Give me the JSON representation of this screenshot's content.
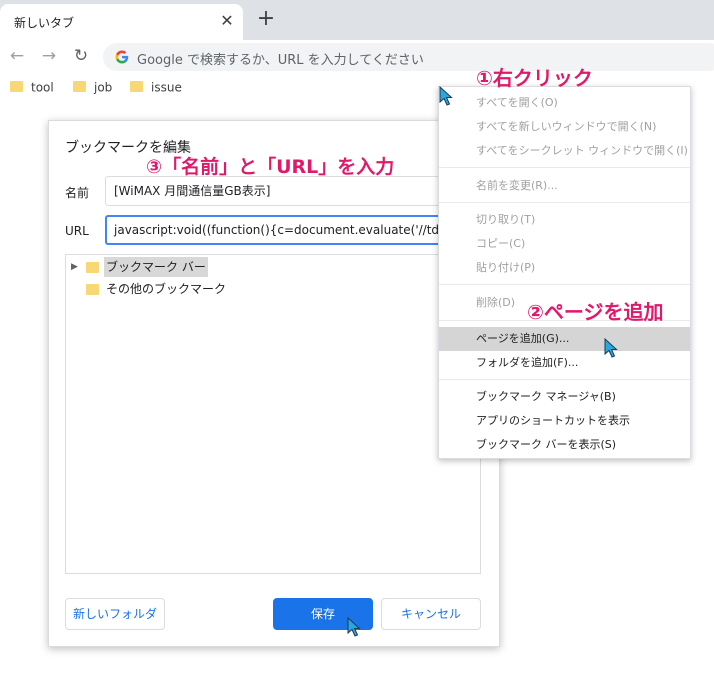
{
  "tab": {
    "title": "新しいタブ",
    "close_glyph": "✕",
    "new_tab_glyph": "+"
  },
  "toolbar": {
    "back_glyph": "←",
    "forward_glyph": "→",
    "reload_glyph": "↻",
    "omnibox_placeholder": "Google で検索するか、URL を入力してください"
  },
  "bookmarks_bar": [
    {
      "label": "tool",
      "icon": "folder-icon"
    },
    {
      "label": "job",
      "icon": "folder-icon"
    },
    {
      "label": "issue",
      "icon": "folder-icon"
    }
  ],
  "dialog": {
    "title": "ブックマークを編集",
    "name_label": "名前",
    "name_value": "[WiMAX 月間通信量GB表示]",
    "url_label": "URL",
    "url_value": "javascript:void((function(){c=document.evaluate('//td[@class=\"t_righ",
    "tree": [
      {
        "label": "ブックマーク バー",
        "selected": true,
        "expandable": true,
        "expand_glyph": "▶"
      },
      {
        "label": "その他のブックマーク",
        "selected": false,
        "expandable": false
      }
    ],
    "new_folder_button": "新しいフォルダ",
    "save_button": "保存",
    "cancel_button": "キャンセル"
  },
  "context_menu": {
    "items": [
      {
        "label": "すべてを開く(O)",
        "enabled": false
      },
      {
        "label": "すべてを新しいウィンドウで開く(N)",
        "enabled": false
      },
      {
        "label": "すべてをシークレット ウィンドウで開く(I)",
        "enabled": false
      },
      {
        "label": "名前を変更(R)...",
        "enabled": false
      },
      {
        "label": "切り取り(T)",
        "enabled": false
      },
      {
        "label": "コピー(C)",
        "enabled": false
      },
      {
        "label": "貼り付け(P)",
        "enabled": false
      },
      {
        "label": "削除(D)",
        "enabled": false
      },
      {
        "label": "ページを追加(G)...",
        "enabled": true,
        "highlighted": true
      },
      {
        "label": "フォルダを追加(F)...",
        "enabled": true
      },
      {
        "label": "ブックマーク マネージャ(B)",
        "enabled": true
      },
      {
        "label": "アプリのショートカットを表示",
        "enabled": true
      },
      {
        "label": "ブックマーク バーを表示(S)",
        "enabled": true
      }
    ]
  },
  "annotations": {
    "step1": "①右クリック",
    "step2": "②ページを追加",
    "step3": "③「名前」と「URL」を入力"
  },
  "colors": {
    "accent": "#1a73e8",
    "annotation": "#e0196a",
    "folder": "#f8d775",
    "cursor": "#29a8e0"
  }
}
